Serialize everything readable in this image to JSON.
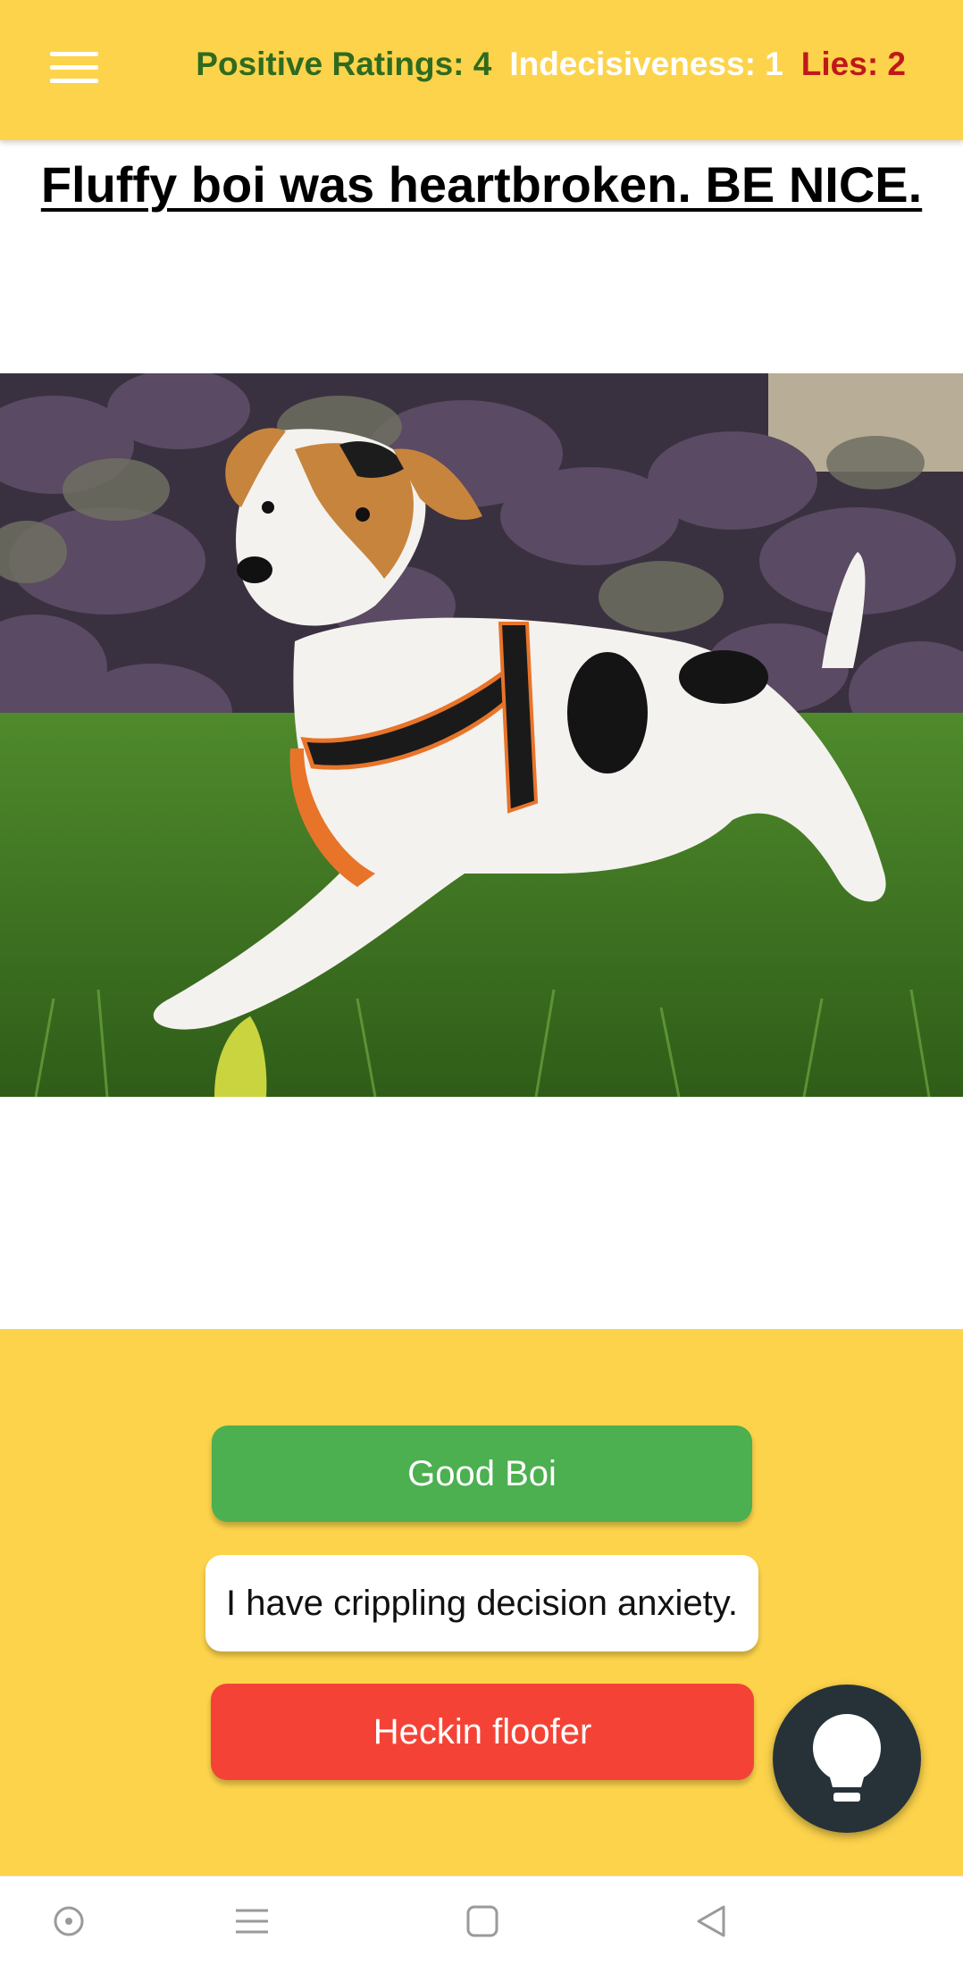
{
  "header": {
    "positive_ratings": "Positive Ratings: 4",
    "indecisiveness": "Indecisiveness: 1",
    "lies": "Lies: 2",
    "menu_icon": "hamburger-menu-icon",
    "colors": {
      "bar": "#FCD34B",
      "positive": "#2E6B1F",
      "indecisive": "#FFFFFF",
      "lies": "#C1171B"
    }
  },
  "main": {
    "title": "Fluffy boi was heartbroken. BE NICE.",
    "image_subject": "jack-russell-terrier-lying-on-grass"
  },
  "actions": {
    "good": "Good Boi",
    "anxiety": "I have crippling decision anxiety.",
    "floofer": "Heckin floofer",
    "colors": {
      "good": "#4CAF50",
      "anxiety": "#FFFFFF",
      "floofer": "#F44336",
      "panel": "#FCD34B"
    }
  },
  "fab": {
    "icon": "lightbulb-icon",
    "color": "#263238"
  },
  "system_nav": {
    "icons": [
      "assistant-dot-icon",
      "recents-menu-icon",
      "home-square-icon",
      "back-triangle-icon"
    ]
  }
}
